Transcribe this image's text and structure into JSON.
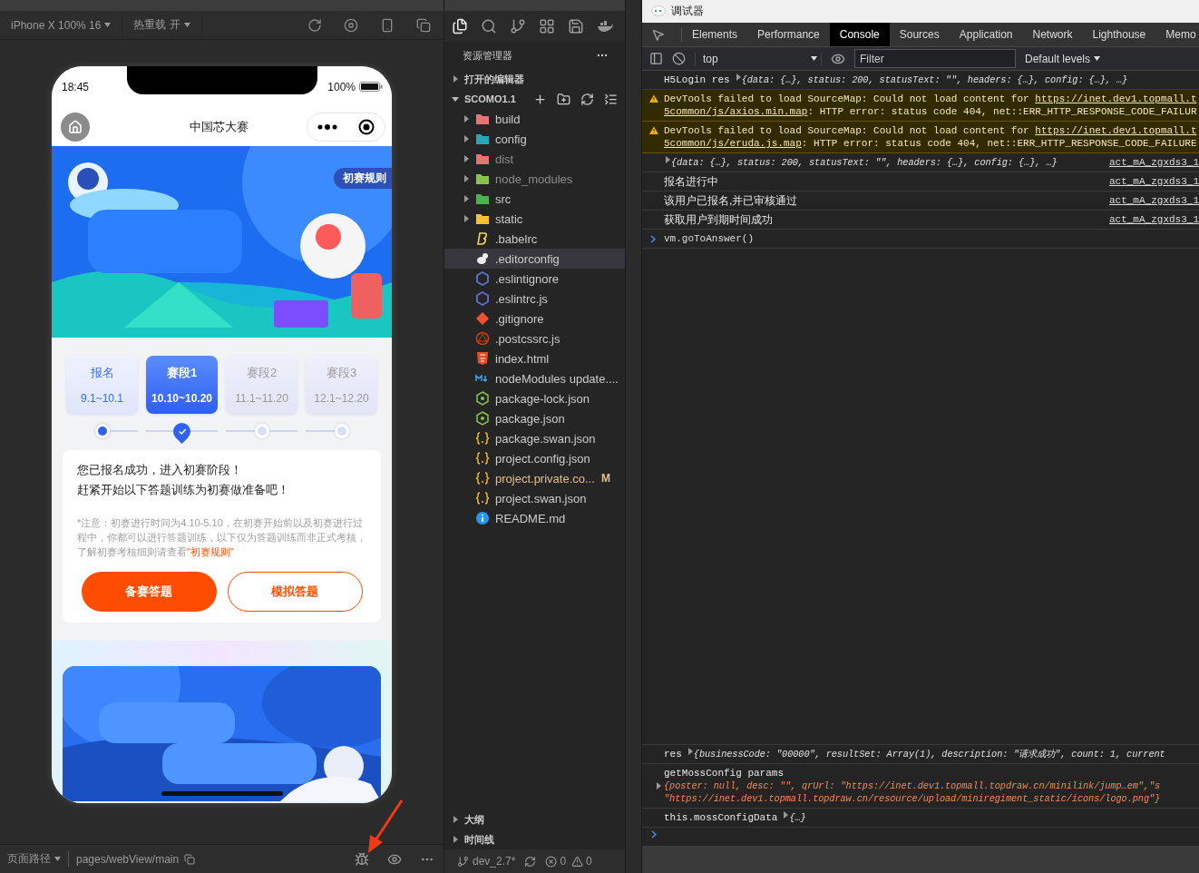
{
  "simulator": {
    "toolbar": {
      "device": "iPhone X 100% 16",
      "hot_reload": "热重载 开"
    },
    "phone": {
      "status_bar": {
        "time": "18:45",
        "battery": "100%"
      },
      "nav": {
        "title": "中国芯大赛"
      },
      "banner": {
        "kind": "picture",
        "badge": "初赛规则"
      },
      "stages": [
        {
          "label": "报名",
          "dates": "9.1~10.1",
          "completed": true,
          "selected": false
        },
        {
          "label": "赛段1",
          "dates": "10.10~10.20",
          "completed": false,
          "selected": true
        },
        {
          "label": "赛段2",
          "dates": "11.1~11.20",
          "completed": false,
          "selected": false
        },
        {
          "label": "赛段3",
          "dates": "12.1~12.20",
          "completed": false,
          "selected": false
        }
      ],
      "message": [
        "您已报名成功，进入初赛阶段！",
        "赶紧开始以下答题训练为初赛做准备吧！"
      ],
      "notice": {
        "text": "*注意：初赛进行时间为4.10-5.10，在初赛开始前以及初赛进行过程中，你都可以进行答题训练，以下仅为答题训练而非正式考核，了解初赛考核细则请查看",
        "link": "\"初赛规则\""
      },
      "buttons": [
        {
          "label": "备赛答题",
          "kind": "primary"
        },
        {
          "label": "模拟答题",
          "kind": "outline"
        }
      ]
    },
    "bottom_bar": {
      "page_path_label": "页面路径",
      "path": "pages/webView/main"
    }
  },
  "explorer": {
    "title": "资源管理器",
    "open_editors": {
      "label": "打开的编辑器",
      "expanded": false
    },
    "project": {
      "label": "SCOMO1.1",
      "expanded": true
    },
    "items": [
      {
        "name": "build",
        "kind": "folder",
        "color": "#e57373",
        "dimmed": false,
        "selected": false
      },
      {
        "name": "config",
        "kind": "folder",
        "color": "#26a6b8",
        "dimmed": false,
        "selected": false
      },
      {
        "name": "dist",
        "kind": "folder",
        "color": "#e57373",
        "dimmed": true,
        "selected": false
      },
      {
        "name": "node_modules",
        "kind": "folder",
        "color": "#8bc34a",
        "dimmed": true,
        "selected": false
      },
      {
        "name": "src",
        "kind": "folder",
        "color": "#4caf50",
        "dimmed": false,
        "selected": false
      },
      {
        "name": "static",
        "kind": "folder",
        "color": "#fbc02d",
        "dimmed": false,
        "selected": false
      },
      {
        "name": ".babelrc",
        "kind": "babel",
        "dimmed": false,
        "selected": false
      },
      {
        "name": ".editorconfig",
        "kind": "editorconfig",
        "dimmed": false,
        "selected": true
      },
      {
        "name": ".eslintignore",
        "kind": "eslint",
        "dimmed": false,
        "selected": false
      },
      {
        "name": ".eslintrc.js",
        "kind": "eslint",
        "dimmed": false,
        "selected": false
      },
      {
        "name": ".gitignore",
        "kind": "git",
        "dimmed": false,
        "selected": false
      },
      {
        "name": ".postcssrc.js",
        "kind": "postcss",
        "dimmed": false,
        "selected": false
      },
      {
        "name": "index.html",
        "kind": "html",
        "dimmed": false,
        "selected": false
      },
      {
        "name": "nodeModules update....",
        "kind": "markdown",
        "dimmed": false,
        "selected": false
      },
      {
        "name": "package-lock.json",
        "kind": "node",
        "dimmed": false,
        "selected": false
      },
      {
        "name": "package.json",
        "kind": "node",
        "dimmed": false,
        "selected": false
      },
      {
        "name": "package.swan.json",
        "kind": "json",
        "dimmed": false,
        "selected": false
      },
      {
        "name": "project.config.json",
        "kind": "json",
        "dimmed": false,
        "selected": false
      },
      {
        "name": "project.private.co...",
        "kind": "json",
        "dimmed": false,
        "selected": false,
        "badge": "M"
      },
      {
        "name": "project.swan.json",
        "kind": "json",
        "dimmed": false,
        "selected": false
      },
      {
        "name": "README.md",
        "kind": "info",
        "dimmed": false,
        "selected": false
      }
    ],
    "bottom_sections": [
      {
        "label": "大纲",
        "expanded": false
      },
      {
        "label": "时间线",
        "expanded": false
      }
    ],
    "status_bar": {
      "branch": "dev_2.7*",
      "errors": "0",
      "warnings": "0"
    }
  },
  "devtools": {
    "title": "调试器",
    "tabs": [
      {
        "label": "Elements",
        "selected": false
      },
      {
        "label": "Performance",
        "selected": false
      },
      {
        "label": "Console",
        "selected": true
      },
      {
        "label": "Sources",
        "selected": false
      },
      {
        "label": "Application",
        "selected": false
      },
      {
        "label": "Network",
        "selected": false
      },
      {
        "label": "Lighthouse",
        "selected": false
      },
      {
        "label": "Memo",
        "selected": false
      }
    ],
    "toolbar": {
      "context": "top",
      "filter_placeholder": "Filter",
      "levels": "Default levels"
    },
    "messages": [
      {
        "kind": "log",
        "text": "H5Login res",
        "preview": "{data: {…}, status: 200, statusText: \"\", headers: {…}, config: {…}, …}"
      },
      {
        "kind": "warning",
        "text_before": "DevTools failed to load SourceMap: Could not load content for ",
        "link_start": "https://inet.dev1.topmall.t",
        "link_end": "5common/js/axios.min.map",
        "text_after": ": HTTP error: status code 404, net::ERR_HTTP_RESPONSE_CODE_FAILUR"
      },
      {
        "kind": "warning",
        "text_before": "DevTools failed to load SourceMap: Could not load content for ",
        "link_start": "https://inet.dev1.topmall.t",
        "link_end": "5common/js/eruda.js.map",
        "text_after": ": HTTP error: status code 404, net::ERR_HTTP_RESPONSE_CODE_FAILURE"
      },
      {
        "kind": "log",
        "preview": "{data: {…}, status: 200, statusText: \"\", headers: {…}, config: {…}, …}",
        "source": "act_mA_zgxds3_1"
      },
      {
        "kind": "log",
        "text": "报名进行中",
        "source": "act_mA_zgxds3_1"
      },
      {
        "kind": "log",
        "text": "该用户已报名,并已审核通过",
        "source": "act_mA_zgxds3_1"
      },
      {
        "kind": "log",
        "text": "获取用户到期时间成功",
        "source": "act_mA_zgxds3_1"
      },
      {
        "kind": "input",
        "text": "vm.goToAnswer()"
      }
    ],
    "later_messages": [
      {
        "kind": "log",
        "text": "res",
        "preview": "{businessCode: \"00000\", resultSet: Array(1), description: \"请求成功\", count: 1, current"
      },
      {
        "kind": "multiline",
        "text": "getMossConfig params",
        "preview_lines": [
          "{poster: null, desc: \"\", qrUrl: \"https://inet.dev1.topmall.topdraw.cn/minilink/jump…em\",\"s",
          "\"https://inet.dev1.topmall.topdraw.cn/resource/upload/miniregiment_static/icons/logo.png\"}"
        ]
      },
      {
        "kind": "log",
        "text": "this.mossConfigData",
        "preview": "{…}"
      },
      {
        "kind": "prompt"
      }
    ]
  }
}
